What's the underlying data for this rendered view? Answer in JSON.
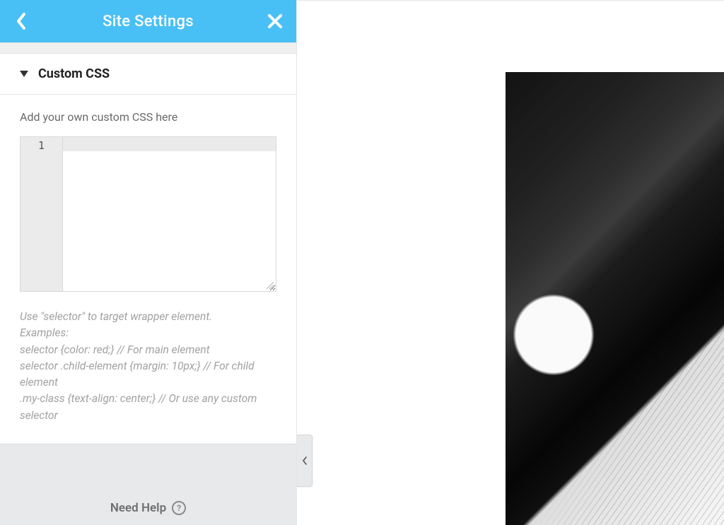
{
  "header": {
    "title": "Site Settings"
  },
  "section": {
    "title": "Custom CSS",
    "description": "Add your own custom CSS here"
  },
  "editor": {
    "first_line_number": "1",
    "value": ""
  },
  "hint": {
    "l1": "Use \"selector\" to target wrapper element.",
    "l2": "Examples:",
    "l3": "selector {color: red;} // For main element",
    "l4": "selector .child-element {margin: 10px;} // For child element",
    "l5": ".my-class {text-align: center;} // Or use any custom selector"
  },
  "footer": {
    "need_help": "Need Help"
  }
}
